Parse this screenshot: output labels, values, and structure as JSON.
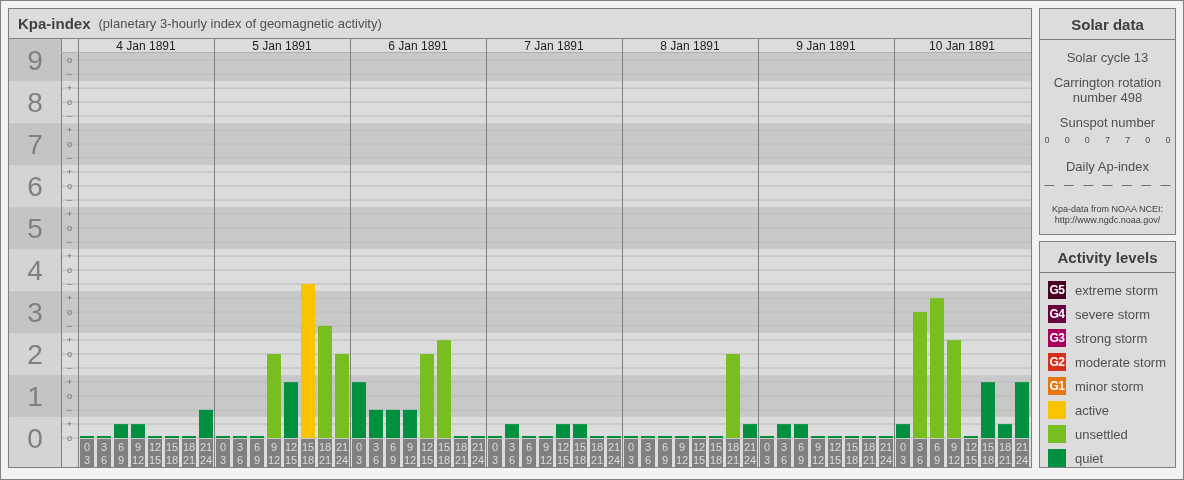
{
  "main_panel": {
    "title": "Kpa-index",
    "subtitle": "(planetary 3-hourly index of geomagnetic activity)",
    "chart_data": {
      "type": "bar",
      "ylim": [
        0,
        9.17
      ],
      "grid": true,
      "yticks": [
        {
          "value": 0,
          "label": "0"
        },
        {
          "value": 1,
          "label": "1"
        },
        {
          "value": 2,
          "label": "2"
        },
        {
          "value": 3,
          "label": "3"
        },
        {
          "value": 4,
          "label": "4"
        },
        {
          "value": 5,
          "label": "5"
        },
        {
          "value": 6,
          "label": "6"
        },
        {
          "value": 7,
          "label": "7"
        },
        {
          "value": 8,
          "label": "8"
        },
        {
          "value": 9,
          "label": "9"
        }
      ],
      "values": [
        0,
        0,
        0.33,
        0.33,
        0,
        0,
        0,
        0.67,
        0,
        0,
        0,
        2,
        1.33,
        3.67,
        2.67,
        2,
        1.33,
        0.67,
        0.67,
        0.67,
        2,
        2.33,
        0,
        0,
        0,
        0.33,
        0,
        0,
        0.33,
        0.33,
        0,
        0,
        0,
        0,
        0,
        0,
        0,
        0,
        2,
        0.33,
        0,
        0.33,
        0.33,
        0,
        0,
        0,
        0,
        0,
        0.33,
        3,
        3.33,
        2.33,
        0,
        1.33,
        0.33,
        1.33
      ]
    },
    "minor_ticks": [
      "o",
      "−",
      "+",
      "o",
      "−",
      "+",
      "o",
      "−",
      "+",
      "o",
      "−",
      "+",
      "o",
      "−",
      "+",
      "o",
      "−",
      "+",
      "o",
      "−",
      "+",
      "o",
      "−",
      "+",
      "o",
      "−",
      "+",
      "o"
    ],
    "days": [
      {
        "date": "4 Jan 1891",
        "slots": [
          [
            "0",
            "3"
          ],
          [
            "3",
            "6"
          ],
          [
            "6",
            "9"
          ],
          [
            "9",
            "12"
          ],
          [
            "12",
            "15"
          ],
          [
            "15",
            "18"
          ],
          [
            "18",
            "21"
          ],
          [
            "21",
            "24"
          ]
        ]
      },
      {
        "date": "5 Jan 1891",
        "slots": [
          [
            "0",
            "3"
          ],
          [
            "3",
            "6"
          ],
          [
            "6",
            "9"
          ],
          [
            "9",
            "12"
          ],
          [
            "12",
            "15"
          ],
          [
            "15",
            "18"
          ],
          [
            "18",
            "21"
          ],
          [
            "21",
            "24"
          ]
        ]
      },
      {
        "date": "6 Jan 1891",
        "slots": [
          [
            "0",
            "3"
          ],
          [
            "3",
            "6"
          ],
          [
            "6",
            "9"
          ],
          [
            "9",
            "12"
          ],
          [
            "12",
            "15"
          ],
          [
            "15",
            "18"
          ],
          [
            "18",
            "21"
          ],
          [
            "21",
            "24"
          ]
        ]
      },
      {
        "date": "7 Jan 1891",
        "slots": [
          [
            "0",
            "3"
          ],
          [
            "3",
            "6"
          ],
          [
            "6",
            "9"
          ],
          [
            "9",
            "12"
          ],
          [
            "12",
            "15"
          ],
          [
            "15",
            "18"
          ],
          [
            "18",
            "21"
          ],
          [
            "21",
            "24"
          ]
        ]
      },
      {
        "date": "8 Jan 1891",
        "slots": [
          [
            "0",
            "3"
          ],
          [
            "3",
            "6"
          ],
          [
            "6",
            "9"
          ],
          [
            "9",
            "12"
          ],
          [
            "12",
            "15"
          ],
          [
            "15",
            "18"
          ],
          [
            "18",
            "21"
          ],
          [
            "21",
            "24"
          ]
        ]
      },
      {
        "date": "9 Jan 1891",
        "slots": [
          [
            "0",
            "3"
          ],
          [
            "3",
            "6"
          ],
          [
            "6",
            "9"
          ],
          [
            "9",
            "12"
          ],
          [
            "12",
            "15"
          ],
          [
            "15",
            "18"
          ],
          [
            "18",
            "21"
          ],
          [
            "21",
            "24"
          ]
        ]
      },
      {
        "date": "10 Jan 1891",
        "slots": [
          [
            "0",
            "3"
          ],
          [
            "3",
            "6"
          ],
          [
            "6",
            "9"
          ],
          [
            "9",
            "12"
          ],
          [
            "12",
            "15"
          ],
          [
            "15",
            "18"
          ],
          [
            "18",
            "21"
          ],
          [
            "21",
            "24"
          ]
        ]
      }
    ]
  },
  "solar_data": {
    "title": "Solar data",
    "solar_cycle": "Solar cycle 13",
    "carrington": "Carrington rotation number 498",
    "sunspot_label": "Sunspot number",
    "sunspot_numbers": [
      "0",
      "0",
      "0",
      "7",
      "7",
      "0",
      "0"
    ],
    "ap_label": "Daily Ap-index",
    "ap_values": [
      "—",
      "—",
      "—",
      "—",
      "—",
      "—",
      "—"
    ],
    "source_lines": [
      "Kpa-data from NOAA NCEI:",
      "http://www.ngdc.noaa.gov/"
    ]
  },
  "activity_levels": {
    "title": "Activity levels",
    "items": [
      {
        "badge": "G5",
        "label": "extreme storm",
        "color": "#4a0022"
      },
      {
        "badge": "G4",
        "label": "severe storm",
        "color": "#6a0040"
      },
      {
        "badge": "G3",
        "label": "strong storm",
        "color": "#a8005c"
      },
      {
        "badge": "G2",
        "label": "moderate storm",
        "color": "#d82e1c"
      },
      {
        "badge": "G1",
        "label": "minor storm",
        "color": "#e8760c"
      },
      {
        "label": "active",
        "color": "#f8c400"
      },
      {
        "label": "unsettled",
        "color": "#78be20"
      },
      {
        "label": "quiet",
        "color": "#009040"
      }
    ]
  }
}
